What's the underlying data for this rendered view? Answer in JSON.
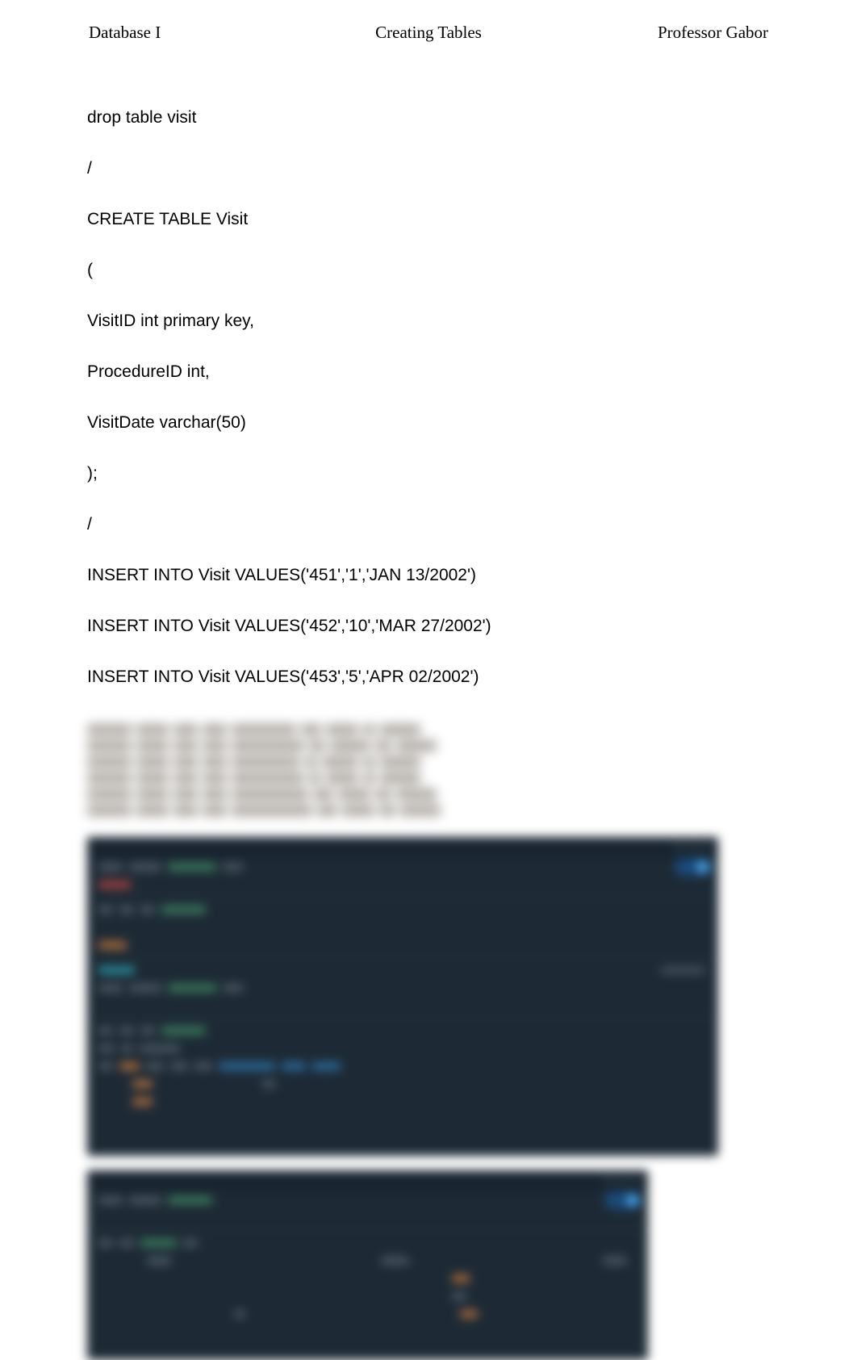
{
  "header": {
    "left": "Database I",
    "center": "Creating Tables",
    "right": "Professor Gabor"
  },
  "code_lines": [
    "drop table visit",
    "/",
    "CREATE TABLE Visit",
    "(",
    "VisitID int primary key,",
    "ProcedureID int,",
    "VisitDate varchar(50)",
    ");",
    "/",
    "INSERT INTO Visit VALUES('451','1','JAN 13/2002')",
    "INSERT INTO Visit VALUES('452','10','MAR 27/2002')",
    "INSERT INTO Visit VALUES('453','5','APR 02/2002')"
  ]
}
